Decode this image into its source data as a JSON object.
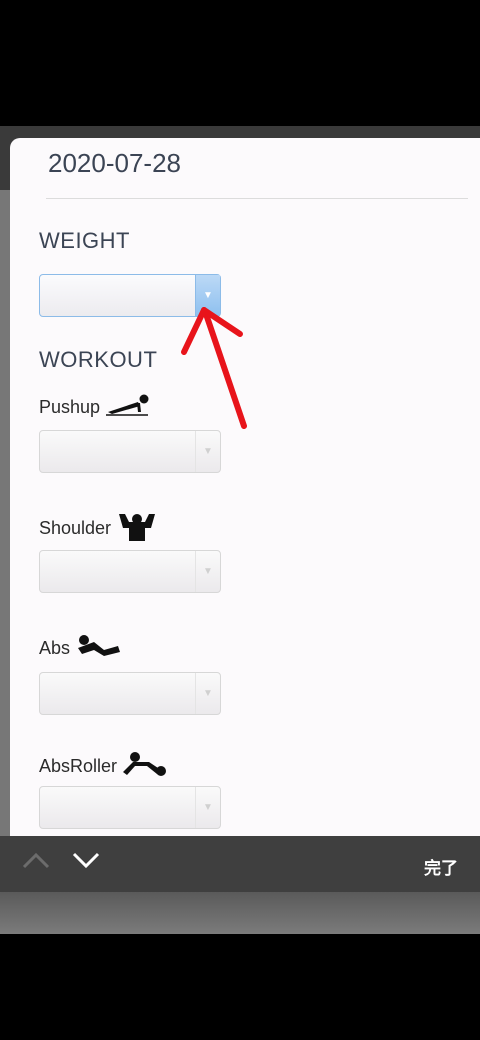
{
  "date": "2020-07-28",
  "weight": {
    "title": "WEIGHT"
  },
  "workout": {
    "title": "WORKOUT",
    "exercises": [
      {
        "label": "Pushup",
        "icon": "pushup-icon"
      },
      {
        "label": "Shoulder",
        "icon": "shoulder-press-icon"
      },
      {
        "label": "Abs",
        "icon": "situp-icon"
      },
      {
        "label": "AbsRoller",
        "icon": "ab-roller-icon"
      }
    ]
  },
  "toolbar": {
    "done_label": "完了"
  },
  "colors": {
    "arrow": "#e8141b",
    "active_select": "#8ec0ef",
    "heading": "#3b4454"
  }
}
